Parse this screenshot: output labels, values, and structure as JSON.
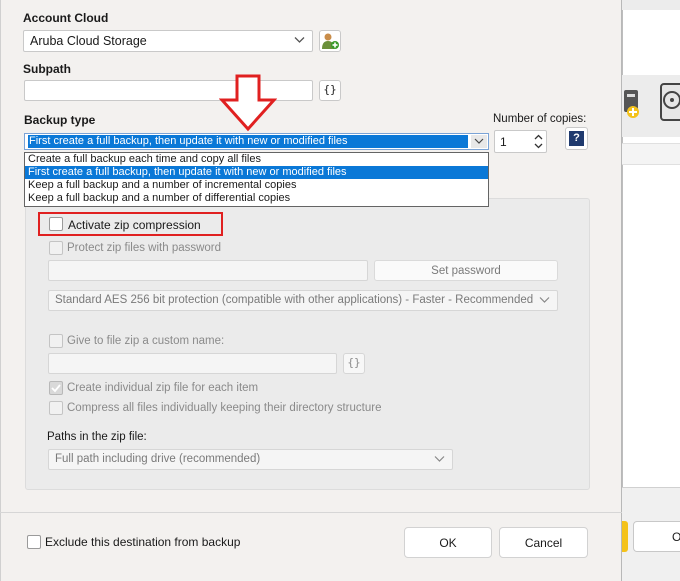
{
  "account_cloud": {
    "label": "Account Cloud",
    "selected": "Aruba Cloud Storage",
    "icon": "user-add-icon"
  },
  "subpath": {
    "label": "Subpath",
    "value": "",
    "button": "{}"
  },
  "backup_type": {
    "label": "Backup type",
    "selected": "First create a full backup, then update it with new or modified files",
    "options": [
      "Create a full backup each time and copy all files",
      "First create a full backup, then update it with new or modified files",
      "Keep a full backup and a number of incremental copies",
      "Keep a full backup and a number of differential copies"
    ],
    "selected_index": 1
  },
  "copies": {
    "label": "Number of copies:",
    "value": "1",
    "help": "?"
  },
  "zip": {
    "activate_label": "Activate zip compression",
    "protect_label": "Protect zip files with password",
    "password_value": "",
    "set_password_button": "Set password",
    "encryption_selected": "Standard AES 256 bit protection (compatible with other applications) - Faster - Recommended",
    "custom_name_label": "Give to file zip a custom name:",
    "custom_name_value": "",
    "custom_name_button": "{}",
    "individual_label": "Create individual zip file for each item",
    "individual_checked": true,
    "compress_individually_label": "Compress all files individually keeping their directory structure",
    "paths_label": "Paths in the zip file:",
    "paths_selected": "Full path including drive (recommended)"
  },
  "footer": {
    "exclude_label": "Exclude this destination from backup",
    "ok_button": "OK",
    "cancel_button": "Cancel"
  },
  "background_window": {
    "ok_fragment": "Ol"
  },
  "colors": {
    "selection": "#0a78d7",
    "highlight_border": "#e02020",
    "arrow": "#e02020"
  }
}
